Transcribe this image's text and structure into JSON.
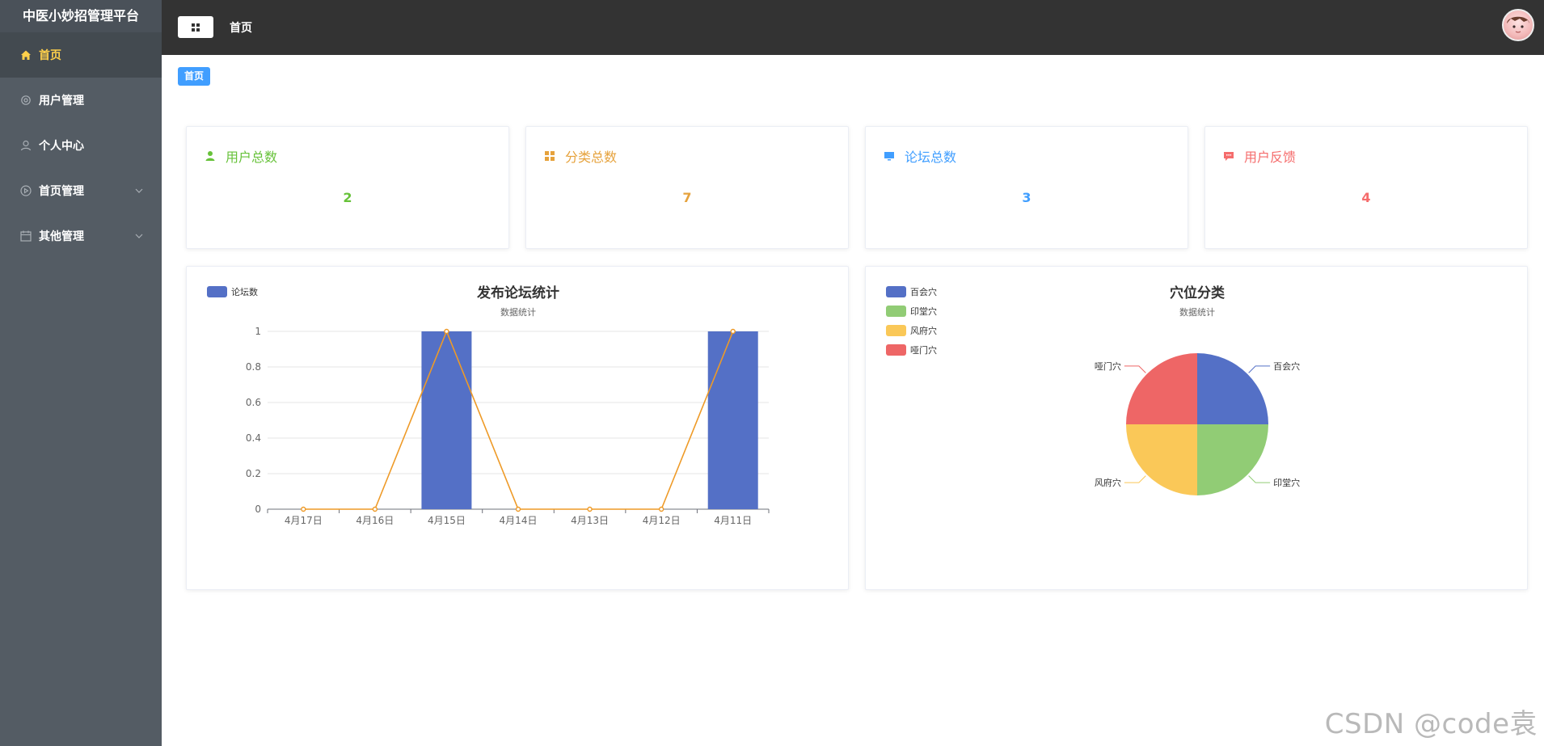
{
  "app": {
    "title": "中医小妙招管理平台"
  },
  "sidebar": {
    "items": [
      {
        "label": "首页",
        "icon": "home-icon",
        "active": true
      },
      {
        "label": "用户管理",
        "icon": "gear-icon",
        "active": false
      },
      {
        "label": "个人中心",
        "icon": "user-icon",
        "active": false
      },
      {
        "label": "首页管理",
        "icon": "play-circle-icon",
        "active": false,
        "has_submenu": true
      },
      {
        "label": "其他管理",
        "icon": "calendar-icon",
        "active": false,
        "has_submenu": true
      }
    ]
  },
  "topbar": {
    "title": "首页"
  },
  "breadcrumb": {
    "label": "首页"
  },
  "stats": [
    {
      "label": "用户总数",
      "value": "2",
      "color": "#67c23a",
      "icon": "user-icon"
    },
    {
      "label": "分类总数",
      "value": "7",
      "color": "#e6a23c",
      "icon": "grid-icon"
    },
    {
      "label": "论坛总数",
      "value": "3",
      "color": "#409eff",
      "icon": "monitor-icon"
    },
    {
      "label": "用户反馈",
      "value": "4",
      "color": "#f56c6c",
      "icon": "chat-icon"
    }
  ],
  "chart_data": [
    {
      "type": "bar",
      "title": "发布论坛统计",
      "subtitle": "数据统计",
      "legend": "top-left",
      "categories": [
        "4月17日",
        "4月16日",
        "4月15日",
        "4月14日",
        "4月13日",
        "4月12日",
        "4月11日"
      ],
      "series": [
        {
          "name": "论坛数",
          "type": "bar",
          "color": "#5470c6",
          "values": [
            0,
            0,
            1,
            0,
            0,
            0,
            1
          ]
        },
        {
          "type": "line",
          "color": "#ee9a27",
          "values": [
            0,
            0,
            1,
            0,
            0,
            0,
            1
          ]
        }
      ],
      "y_ticks": [
        "0",
        "0.2",
        "0.4",
        "0.6",
        "0.8",
        "1"
      ],
      "ylim": [
        0,
        1
      ],
      "grid": true
    },
    {
      "type": "pie",
      "title": "穴位分类",
      "subtitle": "数据统计",
      "legend": "top-left",
      "slices": [
        {
          "name": "百会穴",
          "value": 1,
          "color": "#5470c6"
        },
        {
          "name": "印堂穴",
          "value": 1,
          "color": "#91cc75"
        },
        {
          "name": "风府穴",
          "value": 1,
          "color": "#fac858"
        },
        {
          "name": "哑门穴",
          "value": 1,
          "color": "#ee6666"
        }
      ]
    }
  ],
  "watermark": "CSDN @code袁"
}
